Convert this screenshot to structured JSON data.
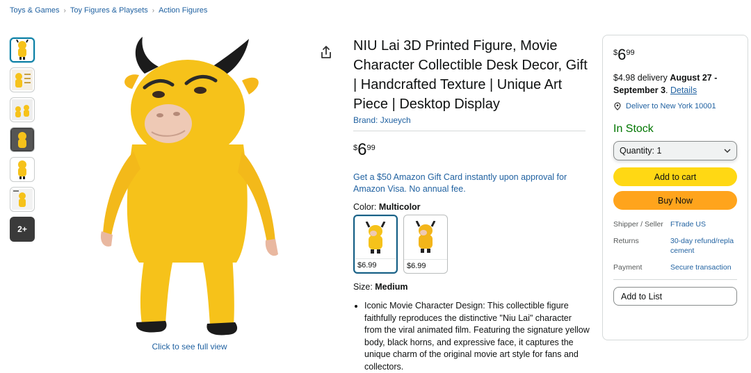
{
  "breadcrumb": [
    "Toys & Games",
    "Toy Figures & Playsets",
    "Action Figures"
  ],
  "breadcrumb_separator": "›",
  "gallery": {
    "more_label": "2+",
    "see_full": "Click to see full view"
  },
  "product": {
    "title": "NIU Lai 3D Printed Figure, Movie Character Collectible Desk Decor, Gift | Handcrafted Texture | Unique Art Piece | Desktop Display",
    "brand": "Brand: Jxueych",
    "price": {
      "symbol": "$",
      "whole": "6",
      "fraction": "99"
    },
    "promo": "Get a $50 Amazon Gift Card instantly upon approval for Amazon Visa. No annual fee.",
    "color_label": "Color: ",
    "color_value": "Multicolor",
    "swatches": [
      {
        "price": "$6.99"
      },
      {
        "price": "$6.99"
      }
    ],
    "size_label": "Size: ",
    "size_value": "Medium",
    "bullets": [
      "Iconic Movie Character Design: This collectible figure faithfully reproduces the distinctive \"Niu Lai\" character from the viral animated film. Featuring the signature yellow body, black horns, and expressive face, it captures the unique charm of the original movie art style for fans and collectors."
    ]
  },
  "buybox": {
    "price": {
      "symbol": "$",
      "whole": "6",
      "fraction": "99"
    },
    "delivery_prefix": "$4.98 delivery ",
    "delivery_dates": "August 27 - September 3",
    "delivery_suffix": ". ",
    "details": "Details",
    "deliver_to": "Deliver to New York 10001",
    "stock": "In Stock",
    "quantity": "Quantity: 1",
    "add_to_cart": "Add to cart",
    "buy_now": "Buy Now",
    "shipper_label": "Shipper / Seller",
    "shipper_value": "FTrade US",
    "returns_label": "Returns",
    "returns_value": "30-day refund/replacement",
    "payment_label": "Payment",
    "payment_value": "Secure transaction",
    "add_to_list": "Add to List"
  },
  "colors": {
    "link": "#2162a1",
    "stock": "#007600",
    "cart_button": "#ffd814",
    "buy_button": "#ffa41c",
    "figure_yellow": "#f6c21a"
  }
}
